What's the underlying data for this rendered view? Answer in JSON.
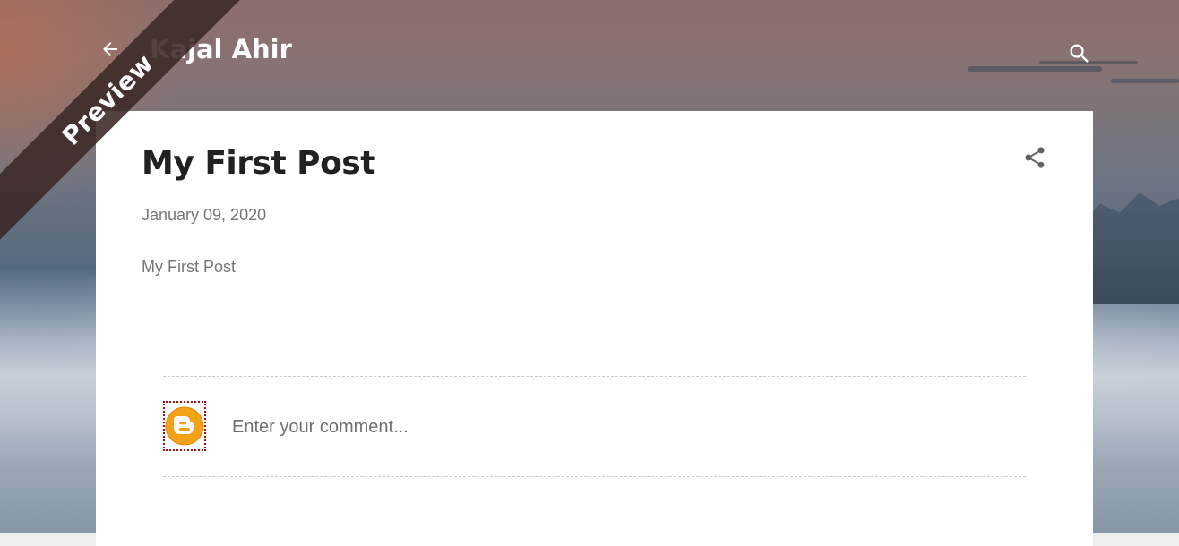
{
  "banner": {
    "label": "Preview"
  },
  "header": {
    "site_title": "Kajal Ahir",
    "back_icon": "arrow-left-icon",
    "search_icon": "search-icon"
  },
  "post": {
    "title": "My First Post",
    "date": "January 09, 2020",
    "body": "My First Post",
    "share_icon": "share-icon"
  },
  "comments": {
    "avatar_icon": "blogger-icon",
    "placeholder": "Enter your comment..."
  },
  "colors": {
    "card_background": "#ffffff",
    "title_text": "#212121",
    "meta_text": "#757575",
    "blogger_orange": "#f4a11a"
  }
}
